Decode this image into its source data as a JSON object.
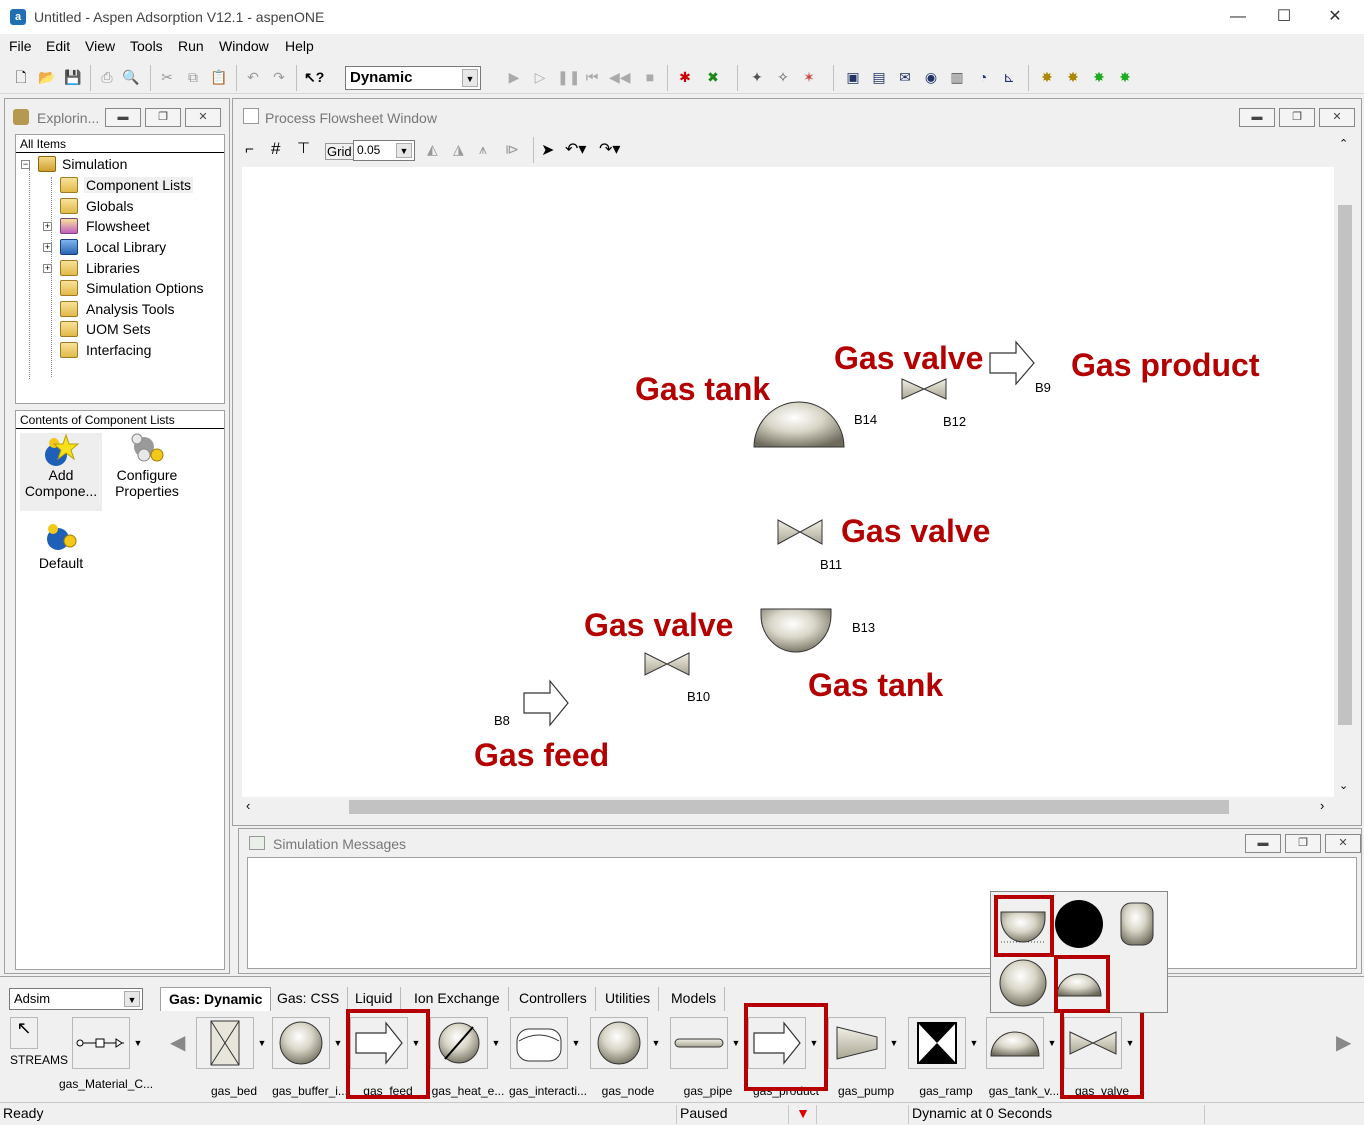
{
  "window": {
    "title": "Untitled - Aspen Adsorption V12.1 - aspenONE",
    "app_icon": "aspen-logo-icon",
    "minimize": "—",
    "maximize": "☐",
    "close": "✕"
  },
  "menu": [
    "File",
    "Edit",
    "View",
    "Tools",
    "Run",
    "Window",
    "Help"
  ],
  "toolbar": {
    "run_mode": "Dynamic"
  },
  "explorer": {
    "title": "Explorin...",
    "tree_header": "All Items",
    "tree": [
      {
        "label": "Simulation",
        "icon": "simulation-icon"
      },
      {
        "label": "Component Lists",
        "icon": "component-lists-icon"
      },
      {
        "label": "Globals",
        "icon": "folder-icon"
      },
      {
        "label": "Flowsheet",
        "icon": "flowsheet-icon"
      },
      {
        "label": "Local Library",
        "icon": "library-icon"
      },
      {
        "label": "Libraries",
        "icon": "folder-icon"
      },
      {
        "label": "Simulation Options",
        "icon": "folder-icon"
      },
      {
        "label": "Analysis Tools",
        "icon": "folder-icon"
      },
      {
        "label": "UOM Sets",
        "icon": "folder-icon"
      },
      {
        "label": "Interfacing",
        "icon": "folder-icon"
      }
    ],
    "contents_header": "Contents of Component Lists",
    "contents": [
      {
        "line1": "Add",
        "line2": "Compone..."
      },
      {
        "line1": "Configure",
        "line2": "Properties"
      },
      {
        "line1": "Default",
        "line2": ""
      }
    ]
  },
  "flowsheet": {
    "title": "Process Flowsheet Window",
    "grid_label": "Grid",
    "grid_value": "0.05",
    "blocks": [
      "B14",
      "B12",
      "B9",
      "B11",
      "B13",
      "B10",
      "B8"
    ],
    "annotations": {
      "gas_tank_top": "Gas tank",
      "gas_valve_top": "Gas valve",
      "gas_product": "Gas product",
      "gas_valve_mid": "Gas valve",
      "gas_valve_low": "Gas valve",
      "gas_tank_low": "Gas tank",
      "gas_feed": "Gas feed"
    }
  },
  "messages": {
    "title": "Simulation Messages"
  },
  "library": {
    "selected": "Adsim",
    "streams_label": "STREAMS",
    "stream_item": "gas_Material_C...",
    "tabs": [
      "Gas: Dynamic",
      "Gas: CSS",
      "Liquid",
      "Ion Exchange",
      "Controllers",
      "Utilities",
      "Models"
    ],
    "items": [
      "gas_bed",
      "gas_buffer_i...",
      "gas_feed",
      "gas_heat_e...",
      "gas_interacti...",
      "gas_node",
      "gas_pipe",
      "gas_product",
      "gas_pump",
      "gas_ramp",
      "gas_tank_v...",
      "gas_valve"
    ]
  },
  "status": {
    "left": "Ready",
    "run_state": "Paused",
    "time": "Dynamic at 0 Seconds"
  }
}
